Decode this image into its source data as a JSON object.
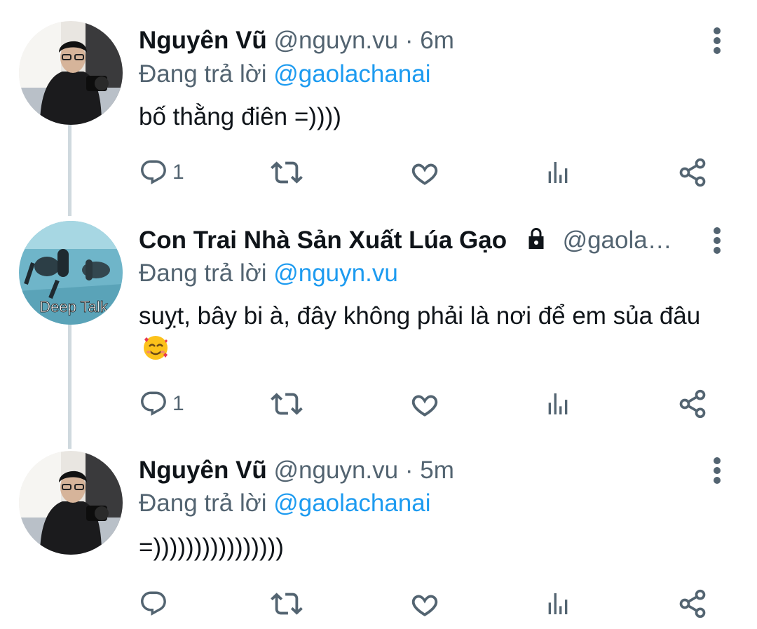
{
  "tweets": [
    {
      "name": "Nguyên Vũ",
      "handle": "@nguyn.vu",
      "separator": "·",
      "time": "6m",
      "replying_prefix": "Đang trả lời",
      "replying_to": "@gaolachanai",
      "text": "bố thằng điên =))))",
      "reply_count": "1",
      "avatar": "person-with-camera"
    },
    {
      "name": "Con Trai Nhà Sản Xuất Lúa Gạo",
      "handle": "@gaola…",
      "locked": true,
      "replying_prefix": "Đang trả lời",
      "replying_to": "@nguyn.vu",
      "text": "suỵt, bây bi à, đây không phải là nơi để em sủa đâu",
      "emoji": "smiling-face-with-hearts",
      "reply_count": "1",
      "avatar": "scuba-divers",
      "avatar_caption": "Deep Talk"
    },
    {
      "name": "Nguyên Vũ",
      "handle": "@nguyn.vu",
      "separator": "·",
      "time": "5m",
      "replying_prefix": "Đang trả lời",
      "replying_to": "@gaolachanai",
      "text": "=))))))))))))))))",
      "reply_count": "",
      "avatar": "person-with-camera"
    }
  ],
  "colors": {
    "link": "#1d9bf0",
    "secondary_text": "#536471",
    "thread_line": "#cfd9de",
    "icon": "#536471"
  }
}
